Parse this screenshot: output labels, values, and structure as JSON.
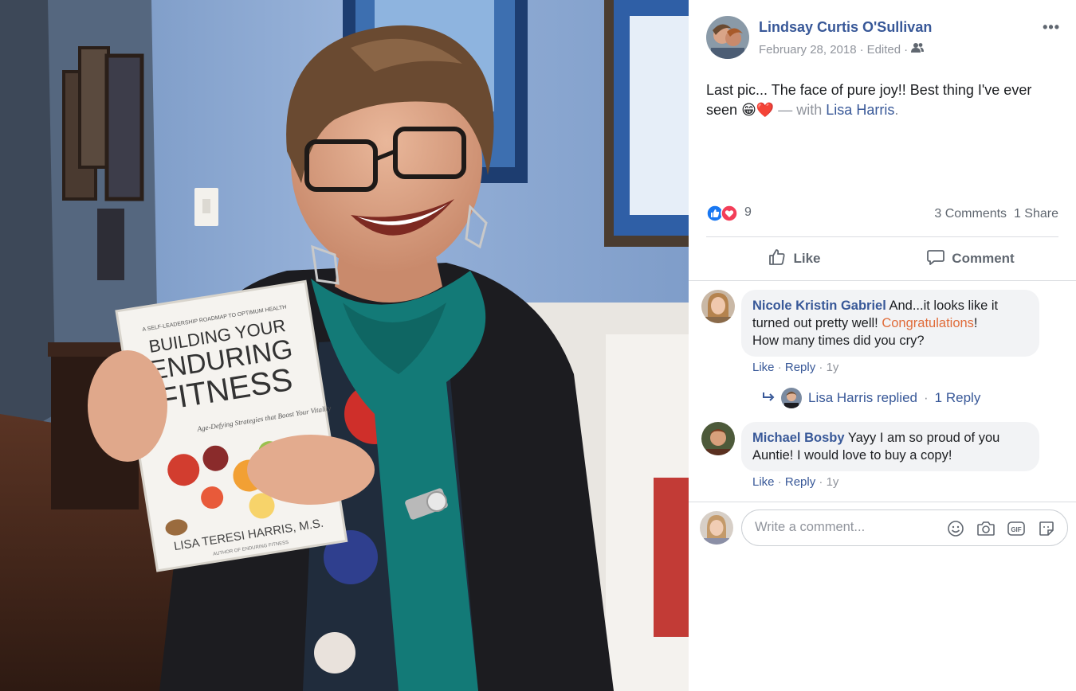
{
  "post": {
    "author": "Lindsay Curtis O'Sullivan",
    "date": "February 28, 2018",
    "edited": "Edited",
    "meta_sep": "·",
    "audience_icon": "friends-icon",
    "more": "•••",
    "text": "Last pic... The face of pure joy!! Best thing I've ever seen",
    "emoji": "😁❤️",
    "with_text": "— with",
    "tagged": "Lisa Harris",
    "tagged_end": "."
  },
  "photo": {
    "book_title_1": "BUILDING YOUR",
    "book_title_2": "ENDURING",
    "book_title_3": "FITNESS",
    "book_kicker": "A SELF-LEADERSHIP ROADMAP TO OPTIMUM HEALTH",
    "book_subtitle": "Age-Defying Strategies that Boost Your Vitality",
    "book_author": "LISA TERESI HARRIS, M.S.",
    "book_author_sub": "AUTHOR OF ENDURING FITNESS"
  },
  "reactions": {
    "count": "9",
    "comments": "3 Comments",
    "shares": "1 Share",
    "icons": [
      "like-reaction-icon",
      "love-reaction-icon"
    ],
    "like_color": "#1877f2",
    "love_color": "#f33e58"
  },
  "actions": {
    "like": "Like",
    "comment": "Comment"
  },
  "comments": [
    {
      "author": "Nicole Kristin Gabriel",
      "text_1": "And...it looks like it",
      "text_2a": "turned out pretty well!",
      "link": "Congratulations",
      "text_2b": "!",
      "text_3": "How many times did you cry?",
      "like": "Like",
      "reply": "Reply",
      "time": "1y",
      "sep": "·"
    },
    {
      "author": "Michael Bosby",
      "text_1": "Yayy I am so proud of you",
      "text_2": "Auntie! I would love to buy a copy!",
      "like": "Like",
      "reply": "Reply",
      "time": "1y",
      "sep": "·"
    }
  ],
  "replies": {
    "text": "Lisa Harris replied",
    "sep": "·",
    "count": "1 Reply"
  },
  "composer": {
    "placeholder": "Write a comment...",
    "tools": [
      "emoji-icon",
      "camera-icon",
      "gif-icon",
      "sticker-icon"
    ],
    "gif_label": "GIF"
  },
  "colors": {
    "link_blue": "#385898",
    "meta_gray": "#90949c",
    "highlight": "#e06c3a"
  }
}
